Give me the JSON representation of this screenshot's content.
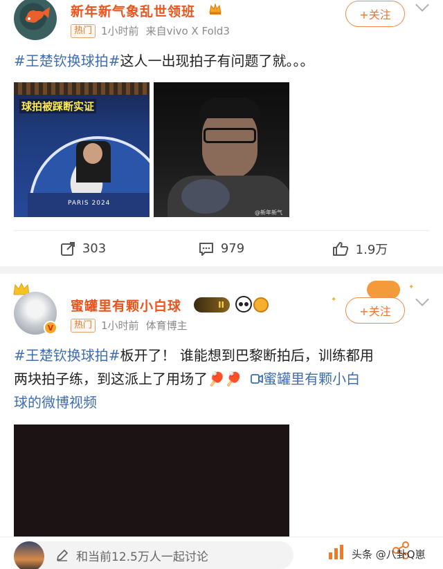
{
  "post1": {
    "username": "新年新气象乱世领班",
    "badge_hot": "热门",
    "time": "1小时前",
    "source": "来自vivo X Fold3",
    "follow_label": "+关注",
    "hashtag": "#王楚钦换球拍#",
    "body": "这人一出现拍子有问题了就。。。",
    "image1_caption": "球拍被踩断实证",
    "image1_sub": "PARIS 2024",
    "image2_watermark": "@新年新气",
    "reposts": "303",
    "comments": "979",
    "likes": "1.9万"
  },
  "post2": {
    "username": "蜜罐里有颗小白球",
    "level_badge": "II",
    "badge_hot": "热门",
    "time": "1小时前",
    "source": "体育博主",
    "follow_label": "+关注",
    "hashtag": "#王楚钦换球拍#",
    "body_line1": "板开了！ 谁能想到巴黎断拍后，训练都用",
    "body_line2": "两块拍子练，到这派上了用场了",
    "emoji": "🏓🏓",
    "video_link_part1": "蜜罐里有颗小白",
    "video_link_part2": "球的微博视频"
  },
  "bottom": {
    "comment_placeholder": "和当前12.5万人一起讨论",
    "watermark": "头条 @八卦Q崽"
  },
  "colors": {
    "username": "#e8541c",
    "hashtag": "#3d6db4",
    "follow": "#f0722a"
  }
}
